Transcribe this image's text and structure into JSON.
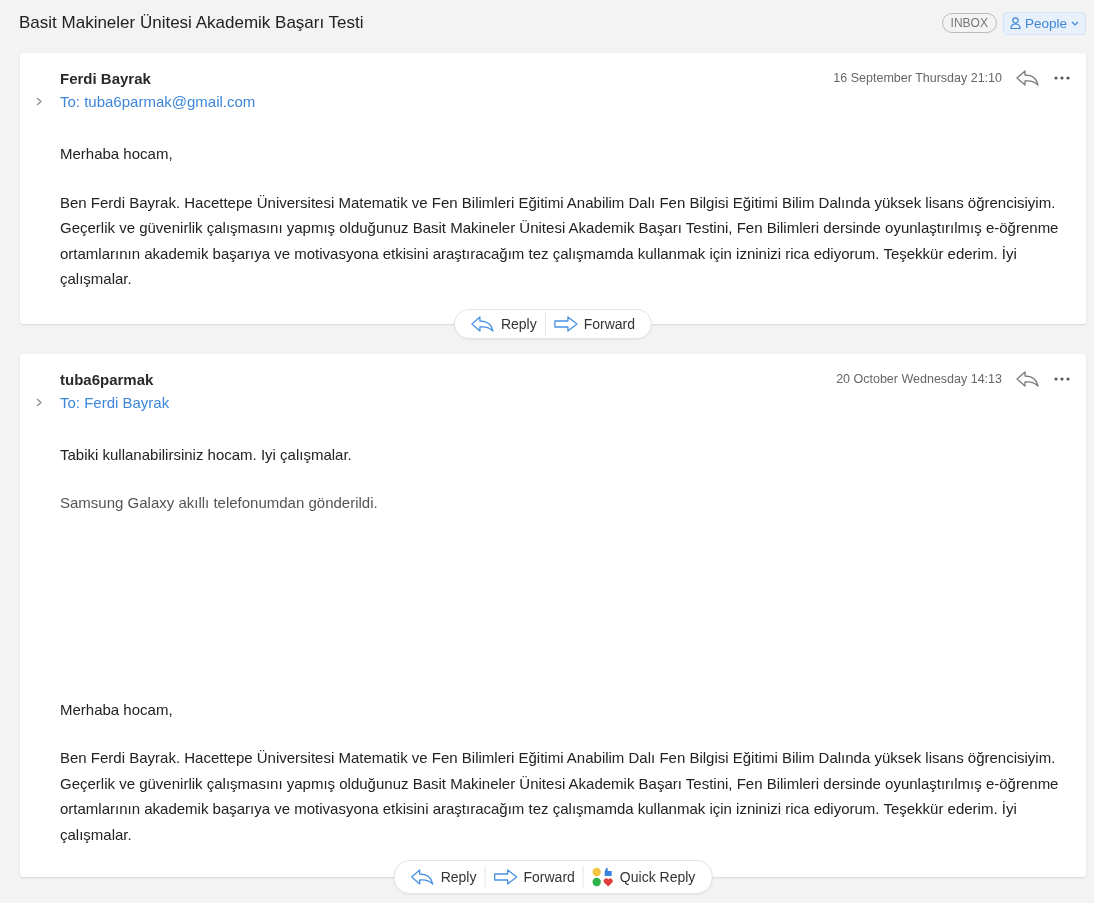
{
  "subject": "Basit Makineler Ünitesi Akademik Başarı Testi",
  "header_badges": {
    "folder": "INBOX",
    "people": "People"
  },
  "messages": [
    {
      "sender": "Ferdi Bayrak",
      "to": "To: tuba6parmak@gmail.com",
      "date": "16 September Thursday 21:10",
      "expanded": false,
      "paragraphs": [
        {
          "kind": "text",
          "text": "Merhaba hocam,"
        },
        {
          "kind": "text",
          "text": "Ben Ferdi Bayrak. Hacettepe Üniversitesi Matematik ve Fen Bilimleri Eğitimi Anabilim Dalı Fen Bilgisi Eğitimi Bilim Dalında yüksek lisans öğrencisiyim. Geçerlik ve güvenirlik çalışmasını yapmış olduğunuz Basit Makineler Ünitesi Akademik Başarı Testini, Fen Bilimleri dersinde oyunlaştırılmış e-öğrenme ortamlarının akademik başarıya ve motivasyona etkisini araştıracağım tez çalışmamda kullanmak için izninizi rica ediyorum. Teşekkür ederim. İyi çalışmalar."
        }
      ],
      "actions": [
        {
          "kind": "reply",
          "label": "Reply"
        },
        {
          "kind": "forward",
          "label": "Forward"
        }
      ]
    },
    {
      "sender": "tuba6parmak",
      "to": "To: Ferdi Bayrak",
      "date": "20 October Wednesday 14:13",
      "expanded": false,
      "paragraphs": [
        {
          "kind": "text",
          "text": "Tabiki kullanabilirsiniz hocam. Iyi çalışmalar."
        },
        {
          "kind": "signature",
          "text": "Samsung Galaxy akıllı telefonumdan gönderildi."
        }
      ],
      "quoted": [
        {
          "kind": "text",
          "text": "Merhaba hocam,"
        },
        {
          "kind": "text",
          "text": "Ben Ferdi Bayrak. Hacettepe Üniversitesi Matematik ve Fen Bilimleri Eğitimi Anabilim Dalı Fen Bilgisi Eğitimi Bilim Dalında yüksek lisans öğrencisiyim. Geçerlik ve güvenirlik çalışmasını yapmış olduğunuz Basit Makineler Ünitesi Akademik Başarı Testini, Fen Bilimleri dersinde oyunlaştırılmış e-öğrenme ortamlarının akademik başarıya ve motivasyona etkisini araştıracağım tez çalışmamda kullanmak için izninizi rica ediyorum. Teşekkür ederim. İyi çalışmalar."
        }
      ],
      "actions": [
        {
          "kind": "reply",
          "label": "Reply"
        },
        {
          "kind": "forward",
          "label": "Forward"
        },
        {
          "kind": "quick",
          "label": "Quick Reply"
        }
      ]
    }
  ]
}
